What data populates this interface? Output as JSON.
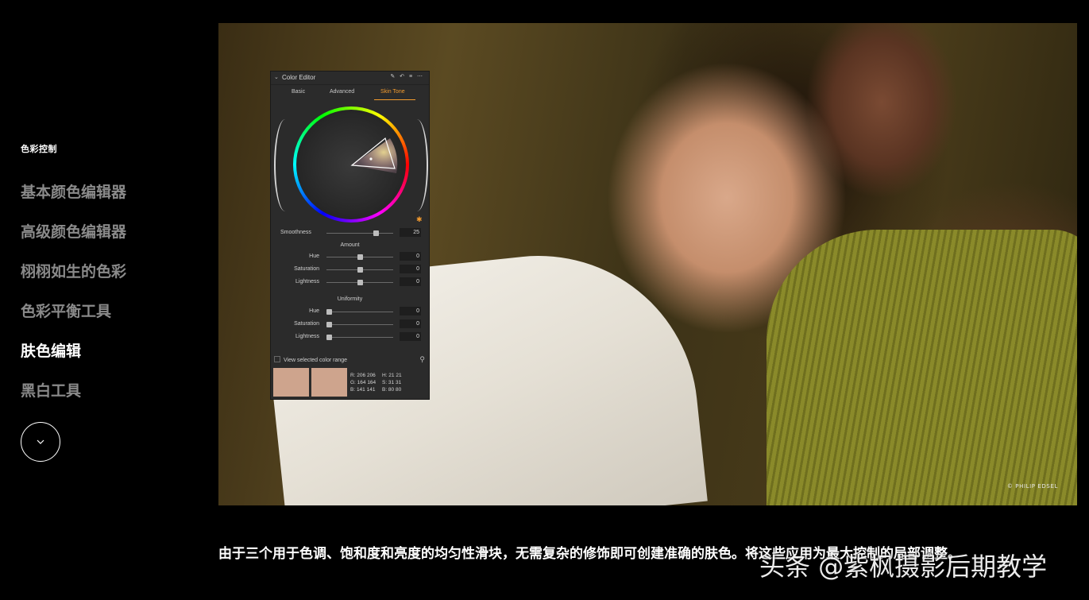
{
  "sidebar": {
    "section_label": "色彩控制",
    "items": [
      {
        "label": "基本颜色编辑器",
        "active": false
      },
      {
        "label": "高级颜色编辑器",
        "active": false
      },
      {
        "label": "栩栩如生的色彩",
        "active": false
      },
      {
        "label": "色彩平衡工具",
        "active": false
      },
      {
        "label": "肤色编辑",
        "active": true
      },
      {
        "label": "黑白工具",
        "active": false
      }
    ],
    "down_icon": "chevron-down-icon"
  },
  "photo": {
    "credit": "© PHILIP EDSEL"
  },
  "color_editor": {
    "title": "Color Editor",
    "tools": "✎ ↶ ≡ ⋯",
    "tabs": [
      {
        "label": "Basic",
        "active": false
      },
      {
        "label": "Advanced",
        "active": false
      },
      {
        "label": "Skin Tone",
        "active": true
      }
    ],
    "smoothness": {
      "label": "Smoothness",
      "value": "25",
      "fraction": 0.77
    },
    "amount": {
      "heading": "Amount",
      "sliders": [
        {
          "label": "Hue",
          "value": "0",
          "fraction": 0.5
        },
        {
          "label": "Saturation",
          "value": "0",
          "fraction": 0.5
        },
        {
          "label": "Lightness",
          "value": "0",
          "fraction": 0.5
        }
      ]
    },
    "uniformity": {
      "heading": "Uniformity",
      "sliders": [
        {
          "label": "Hue",
          "value": "0",
          "fraction": 0.0
        },
        {
          "label": "Saturation",
          "value": "0",
          "fraction": 0.0
        },
        {
          "label": "Lightness",
          "value": "0",
          "fraction": 0.0
        }
      ]
    },
    "view_range_label": "View selected color range",
    "swatch_color": "#cea48d",
    "readout": {
      "r": "R: 206  206",
      "g": "G: 164  164",
      "b": "B: 141  141",
      "h": "H:   21    21",
      "s": "S:   31    31",
      "bv": "B:   80    80"
    }
  },
  "caption": "由于三个用于色调、饱和度和亮度的均匀性滑块，无需复杂的修饰即可创建准确的肤色。将这些应用为最大控制的局部调整。",
  "watermark": "头条 @紫枫摄影后期教学",
  "colors": {
    "accent": "#f29a2e",
    "background": "#000000",
    "inactive_nav": "#8a8a8a"
  }
}
